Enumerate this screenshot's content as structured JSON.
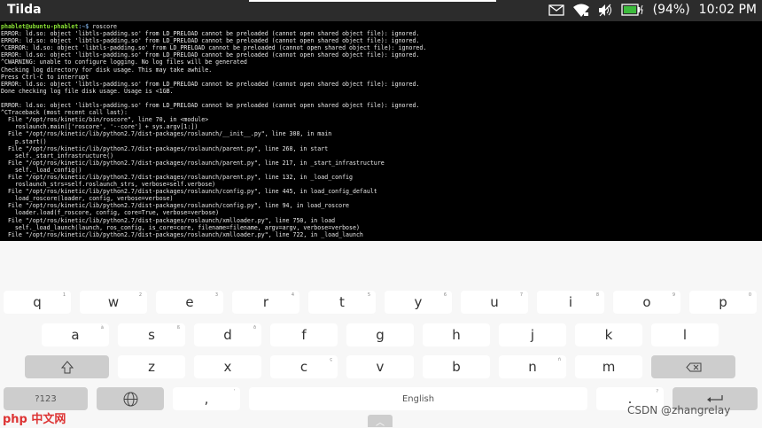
{
  "app": {
    "title": "Tilda"
  },
  "status": {
    "battery": "(94%)",
    "time": "10:02 PM",
    "battery_color": "#3dbb3d"
  },
  "terminal": {
    "prompt_user": "phablet@ubuntu-phablet",
    "prompt_path": ":~$ ",
    "command": "roscore",
    "lines": [
      "ERROR: ld.so: object 'libtls-padding.so' from LD_PRELOAD cannot be preloaded (cannot open shared object file): ignored.",
      "ERROR: ld.so: object 'libtls-padding.so' from LD_PRELOAD cannot be preloaded (cannot open shared object file): ignored.",
      "^CERROR: ld.so: object 'libtls-padding.so' from LD_PRELOAD cannot be preloaded (cannot open shared object file): ignored.",
      "ERROR: ld.so: object 'libtls-padding.so' from LD_PRELOAD cannot be preloaded (cannot open shared object file): ignored.",
      "^CWARNING: unable to configure logging. No log files will be generated",
      "Checking log directory for disk usage. This may take awhile.",
      "Press Ctrl-C to interrupt",
      "ERROR: ld.so: object 'libtls-padding.so' from LD_PRELOAD cannot be preloaded (cannot open shared object file): ignored.",
      "Done checking log file disk usage. Usage is <1GB.",
      "",
      "ERROR: ld.so: object 'libtls-padding.so' from LD_PRELOAD cannot be preloaded (cannot open shared object file): ignored.",
      "^CTraceback (most recent call last):",
      "  File \"/opt/ros/kinetic/bin/roscore\", line 70, in <module>",
      "    roslaunch.main(['roscore', '--core'] + sys.argv[1:])",
      "  File \"/opt/ros/kinetic/lib/python2.7/dist-packages/roslaunch/__init__.py\", line 308, in main",
      "    p.start()",
      "  File \"/opt/ros/kinetic/lib/python2.7/dist-packages/roslaunch/parent.py\", line 268, in start",
      "    self._start_infrastructure()",
      "  File \"/opt/ros/kinetic/lib/python2.7/dist-packages/roslaunch/parent.py\", line 217, in _start_infrastructure",
      "    self._load_config()",
      "  File \"/opt/ros/kinetic/lib/python2.7/dist-packages/roslaunch/parent.py\", line 132, in _load_config",
      "    roslaunch_strs=self.roslaunch_strs, verbose=self.verbose)",
      "  File \"/opt/ros/kinetic/lib/python2.7/dist-packages/roslaunch/config.py\", line 445, in load_config_default",
      "    load_roscore(loader, config, verbose=verbose)",
      "  File \"/opt/ros/kinetic/lib/python2.7/dist-packages/roslaunch/config.py\", line 94, in load_roscore",
      "    loader.load(f_roscore, config, core=True, verbose=verbose)",
      "  File \"/opt/ros/kinetic/lib/python2.7/dist-packages/roslaunch/xmlloader.py\", line 750, in load",
      "    self._load_launch(launch, ros_config, is_core=core, filename=filename, argv=argv, verbose=verbose)",
      "  File \"/opt/ros/kinetic/lib/python2.7/dist-packages/roslaunch/xmlloader.py\", line 722, in _load_launch"
    ]
  },
  "keyboard": {
    "row1": [
      [
        "q",
        "1"
      ],
      [
        "w",
        "2"
      ],
      [
        "e",
        "3"
      ],
      [
        "r",
        "4"
      ],
      [
        "t",
        "5"
      ],
      [
        "y",
        "6"
      ],
      [
        "u",
        "7"
      ],
      [
        "i",
        "8"
      ],
      [
        "o",
        "9"
      ],
      [
        "p",
        "0"
      ]
    ],
    "row2": [
      [
        "a",
        "à"
      ],
      [
        "s",
        "ß"
      ],
      [
        "d",
        "ð"
      ],
      [
        "f",
        ""
      ],
      [
        "g",
        ""
      ],
      [
        "h",
        ""
      ],
      [
        "j",
        ""
      ],
      [
        "k",
        ""
      ],
      [
        "l",
        ""
      ]
    ],
    "row3": [
      [
        "z",
        ""
      ],
      [
        "x",
        ""
      ],
      [
        "c",
        "ç"
      ],
      [
        "v",
        ""
      ],
      [
        "b",
        ""
      ],
      [
        "n",
        "ñ"
      ],
      [
        "m",
        ""
      ]
    ],
    "symbols": "?123",
    "comma": ",",
    "comma_sub": "'",
    "space": "English",
    "period": ".",
    "period_sub": "?"
  },
  "watermarks": {
    "left": "php 中文网",
    "right": "CSDN @zhangrelay"
  }
}
